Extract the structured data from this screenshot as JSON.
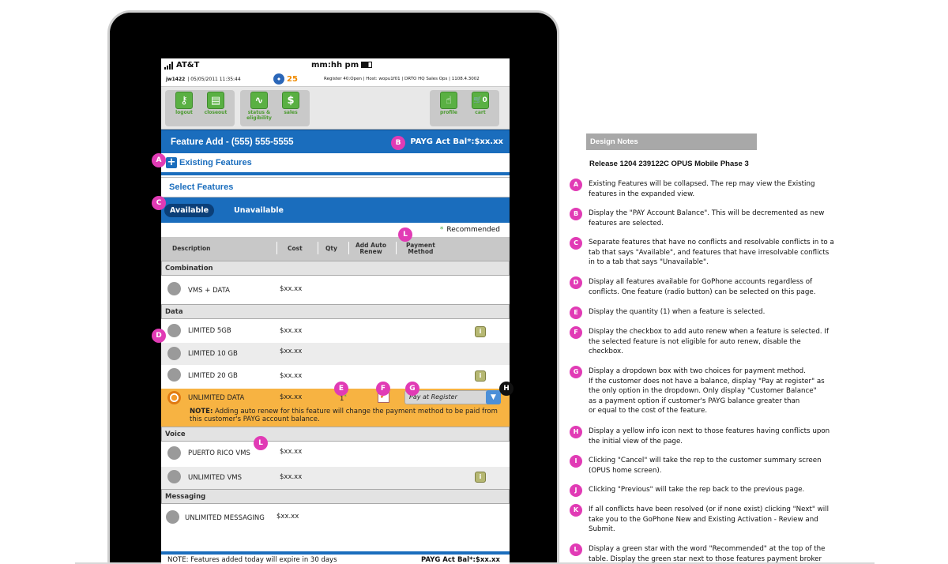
{
  "status_bar": {
    "carrier": "AT&T",
    "clock": "mm:hh pm"
  },
  "info_bar": {
    "user": "jw1422",
    "datetime": "| 05/05/2011 11:35:44",
    "alert_count": "25",
    "register_info": "Register 40:Open | Host: wopu1f01 | DRTO HQ Sales Ops | 1108.4.3002"
  },
  "nav": {
    "left": [
      {
        "icon": "key-icon",
        "glyph": "⚷",
        "label": "logout"
      },
      {
        "icon": "document-icon",
        "glyph": "▤",
        "label": "closeout"
      }
    ],
    "middle": [
      {
        "icon": "pulse-icon",
        "glyph": "∿",
        "label": "status &\neligibility"
      },
      {
        "icon": "dollar-icon",
        "glyph": "$",
        "label": "sales"
      }
    ],
    "right": [
      {
        "icon": "hand-icon",
        "glyph": "☝",
        "label": "profile"
      },
      {
        "icon": "cart-icon",
        "glyph": "🛒0",
        "label": "cart"
      }
    ]
  },
  "header": {
    "title": "Feature Add - (555) 555-5555",
    "balance": "PAYG Act Bal*:$xx.xx"
  },
  "existing_features": {
    "label": "Existing Features",
    "toggle": "+"
  },
  "select_features": {
    "label": "Select Features"
  },
  "tabs": [
    {
      "label": "Available",
      "active": true
    },
    {
      "label": "Unavailable",
      "active": false
    }
  ],
  "recommended": {
    "star": "*",
    "label": "Recommended"
  },
  "table": {
    "headers": {
      "description": "Description",
      "cost": "Cost",
      "qty": "Qty",
      "auto_renew": "Add Auto\nRenew",
      "payment": "Payment\nMethod"
    },
    "groups": [
      {
        "name": "Combination",
        "rows": [
          {
            "desc": "VMS + DATA",
            "cost": "$xx.xx",
            "info": false
          }
        ]
      },
      {
        "name": "Data",
        "rows": [
          {
            "desc": "LIMITED 5GB",
            "cost": "$xx.xx",
            "info": true
          },
          {
            "desc": "LIMITED 10 GB",
            "cost": "$xx.xx",
            "info": false
          },
          {
            "desc": "LIMITED 20 GB",
            "cost": "$xx.xx",
            "info": true
          }
        ]
      },
      {
        "name": "Voice",
        "rows": [
          {
            "desc": "PUERTO RICO VMS",
            "cost": "$xx.xx",
            "info": false
          },
          {
            "desc": "UNLIMITED VMS",
            "cost": "$xx.xx",
            "info": true
          }
        ]
      },
      {
        "name": "Messaging",
        "rows": [
          {
            "desc": "UNLIMITED MESSAGING",
            "cost": "$xx.xx",
            "info": false
          }
        ]
      }
    ],
    "selected_row": {
      "desc": "UNLIMITED DATA",
      "cost": "$xx.xx",
      "qty": "1",
      "qty_star": "*",
      "checkbox": "✓",
      "payment": "Pay at Register",
      "note_label": "NOTE:",
      "note": "Adding auto renew for this feature will change the payment method to be paid from this customer's PAYG account balance."
    }
  },
  "footer": {
    "note": "NOTE: Features added today will expire in 30 days",
    "balance": "PAYG Act Bal*:$xx.xx"
  },
  "markers": {
    "A": "A",
    "B": "B",
    "C": "C",
    "D": "D",
    "E": "E",
    "F": "F",
    "G": "G",
    "H": "H",
    "L": "L"
  },
  "design_notes": {
    "title": "Design Notes",
    "release": "Release 1204 239122C OPUS Mobile Phase 3",
    "items": [
      {
        "badge": "A",
        "text": "Existing Features will be collapsed. The rep may view the Existing\nfeatures in the expanded view."
      },
      {
        "badge": "B",
        "text": "Display the \"PAY Account Balance\". This will be decremented as new\nfeatures are selected."
      },
      {
        "badge": "C",
        "text": "Separate features that have no conflicts and resolvable conflicts in to a\ntab that says \"Available\", and features that have irresolvable conflicts\nin to a tab that says \"Unavailable\"."
      },
      {
        "badge": "D",
        "text": "Display all features available for GoPhone accounts regardless of\nconflicts.  One feature (radio button) can be selected on this page."
      },
      {
        "badge": "E",
        "text": "Display the quantity (1) when a feature is selected."
      },
      {
        "badge": "F",
        "text": "Display the checkbox to add auto renew when a feature is selected. If\nthe selected feature is not eligible for auto renew, disable the\ncheckbox."
      },
      {
        "badge": "G",
        "text": "Display a dropdown box with two choices for payment method.\nIf the customer does not have a balance, display \"Pay at register\" as\nthe only option in the dropdown.  Only display \"Customer Balance\"\nas a payment option if customer's PAYG balance greater than\n or equal to the cost of the feature."
      },
      {
        "badge": "H",
        "text": "Display a yellow info icon next to those features having conflicts upon\nthe initial view of the page."
      },
      {
        "badge": "I",
        "text": "Clicking \"Cancel\" will take the rep to the customer summary screen\n(OPUS home screen)."
      },
      {
        "badge": "J",
        "text": "Clicking \"Previous\" will take the rep back to the previous page."
      },
      {
        "badge": "K",
        "text": "If all conflicts have been resolved (or if none exist) clicking \"Next\" will\ntake you to the GoPhone New and Existing Activation - Review and\nSubmit."
      },
      {
        "badge": "L",
        "text": "Display a green star with the word \"Recommended\" at the top of the\ntable.  Display the green star next to those features payment broker"
      }
    ]
  }
}
